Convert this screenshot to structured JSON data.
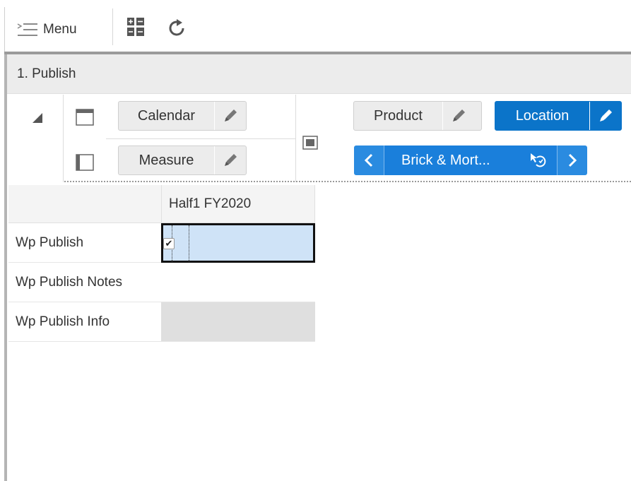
{
  "toolbar": {
    "menu_label": "Menu",
    "icons": [
      "menu-icon",
      "layout-toggle-icon",
      "refresh-icon"
    ]
  },
  "view": {
    "title": "1. Publish"
  },
  "pivot": {
    "row_axis_tiles": [
      {
        "label": "Calendar"
      },
      {
        "label": "Measure"
      }
    ],
    "page_axis_tiles": [
      {
        "label": "Product"
      },
      {
        "label": "Location",
        "active": true
      }
    ],
    "page_selector": {
      "label": "Brick & Mort...",
      "prev_icon": "chevron-left-icon",
      "next_icon": "chevron-right-icon",
      "reset_icon": "cursor-reset-icon"
    }
  },
  "grid": {
    "column_header": "Half1 FY2020",
    "rows": [
      {
        "label": "Wp Publish",
        "checked": true
      },
      {
        "label": "Wp Publish Notes",
        "value": ""
      },
      {
        "label": "Wp Publish Info",
        "value": ""
      }
    ]
  },
  "colors": {
    "accent_blue": "#0b74c9",
    "selected_cell": "#cfe3f7",
    "readonly_cell": "#dfdfdf"
  }
}
